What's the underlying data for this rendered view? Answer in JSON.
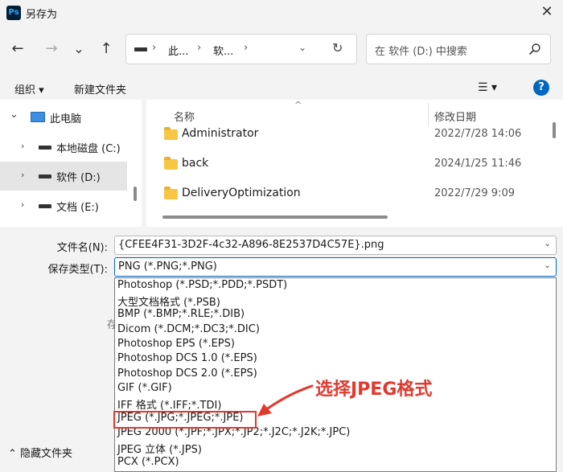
{
  "window": {
    "app_icon_text": "Ps",
    "title": "另存为",
    "close_symbol": "✕"
  },
  "nav": {
    "back": "←",
    "forward": "→",
    "recent": "⌄",
    "up": "↑"
  },
  "address": {
    "segments": [
      "此...",
      "软..."
    ],
    "separator": "›",
    "dropdown": "⌄",
    "refresh": "↻"
  },
  "search": {
    "placeholder": "在 软件 (D:) 中搜索"
  },
  "toolbar": {
    "organize": "组织 ▾",
    "new_folder": "新建文件夹",
    "view": "☰ ▾",
    "help": "?"
  },
  "navpane": {
    "items": [
      {
        "label": "此电脑",
        "chevron": "⌄"
      },
      {
        "label": "本地磁盘 (C:)",
        "chevron": "›"
      },
      {
        "label": "软件 (D:)",
        "chevron": "›"
      },
      {
        "label": "文档 (E:)",
        "chevron": "›"
      }
    ]
  },
  "filelist": {
    "columns": {
      "name": "名称",
      "modified": "修改日期"
    },
    "sort_indicator": "^",
    "rows": [
      {
        "name": "Administrator",
        "date": "2022/7/28 14:06"
      },
      {
        "name": "back",
        "date": "2024/1/25 11:46"
      },
      {
        "name": "DeliveryOptimization",
        "date": "2022/7/29 9:09"
      }
    ]
  },
  "form": {
    "filename_label": "文件名(N):",
    "filename_value": "{CFEE4F31-3D2F-4c32-A896-8E2537D4C57E}.png",
    "type_label": "保存类型(T):",
    "type_value": "PNG (*.PNG;*.PNG)",
    "arrow": "⌄",
    "partially_hidden_label": "存"
  },
  "dropdown_options": [
    "Photoshop (*.PSD;*.PDD;*.PSDT)",
    "大型文档格式 (*.PSB)",
    "BMP (*.BMP;*.RLE;*.DIB)",
    "Dicom (*.DCM;*.DC3;*.DIC)",
    "Photoshop EPS (*.EPS)",
    "Photoshop DCS 1.0 (*.EPS)",
    "Photoshop DCS 2.0 (*.EPS)",
    "GIF (*.GIF)",
    "IFF 格式 (*.IFF;*.TDI)",
    "JPEG (*.JPG;*.JPEG;*.JPE)",
    "JPEG 2000 (*.JPF;*.JPX;*.JP2;*.J2C;*.J2K;*.JPC)",
    "JPEG 立体 (*.JPS)",
    "PCX (*.PCX)"
  ],
  "annotation": {
    "text": "选择JPEG格式",
    "color": "#e03a2f"
  },
  "bottom": {
    "hide_folders": "⌃  隐藏文件夹"
  }
}
